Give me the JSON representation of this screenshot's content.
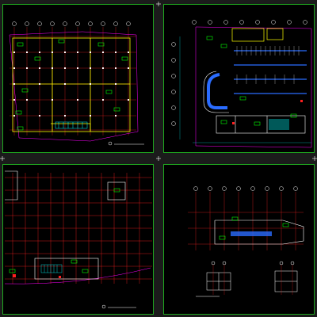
{
  "sheets": [
    {
      "caption": "",
      "scale": ""
    },
    {
      "caption": "",
      "scale": ""
    },
    {
      "caption": "",
      "scale": ""
    },
    {
      "caption": "",
      "scale": ""
    }
  ],
  "colors": {
    "background": "#000000",
    "frame": "#1fa81f",
    "wall": "#ffff00",
    "grid": "#ff2020",
    "column": "#ffffff",
    "parking": "#2a6cff",
    "dimension": "#00ffff",
    "annotation": "#00ff00",
    "boundary": "#ff00ff"
  }
}
